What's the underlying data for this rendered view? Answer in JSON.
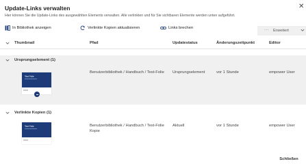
{
  "dialog": {
    "title": "Update-Links verwalten",
    "subtitle": "Hier können Sie die Update-Links des ausgewählten Elements verwalten. Alle verlinkten und für Sie sichtbaren Elemente werden unten aufgeführt.",
    "close_glyph": "✕"
  },
  "toolbar": {
    "show_in_library": "In Bibliothek anzeigen",
    "update_linked_copies": "Verlinkte Kopien aktualisieren",
    "break_links": "Links brechen",
    "more_dots": "···",
    "advanced": "Erweitert"
  },
  "table": {
    "columns": {
      "thumbnail": "Thumbnail",
      "path": "Pfad",
      "status": "Updatestatus",
      "changed": "Änderungszeitpunkt",
      "editor": "Editor"
    },
    "groups": [
      {
        "label": "Ursprungselement (1)",
        "rows": [
          {
            "thumb_title": "Test Folie",
            "path": "Benutzerbibliothek / Handbuch / Test-Folie",
            "status": "Ursprungselement",
            "changed": "vor 1 Stunde",
            "editor": "empower User"
          }
        ]
      },
      {
        "label": "Verlinkte Kopien (1)",
        "rows": [
          {
            "thumb_title": "Test Folie",
            "path": "Benutzerbibliothek / Handbuch / Test-Folie Kopie",
            "status": "Aktuell",
            "changed": "vor 1 Stunde",
            "editor": "empower User"
          }
        ]
      }
    ]
  },
  "footer": {
    "close_label": "Schließen"
  },
  "colors": {
    "accent": "#1d3b78",
    "group_bg": "#f0f0f0"
  }
}
